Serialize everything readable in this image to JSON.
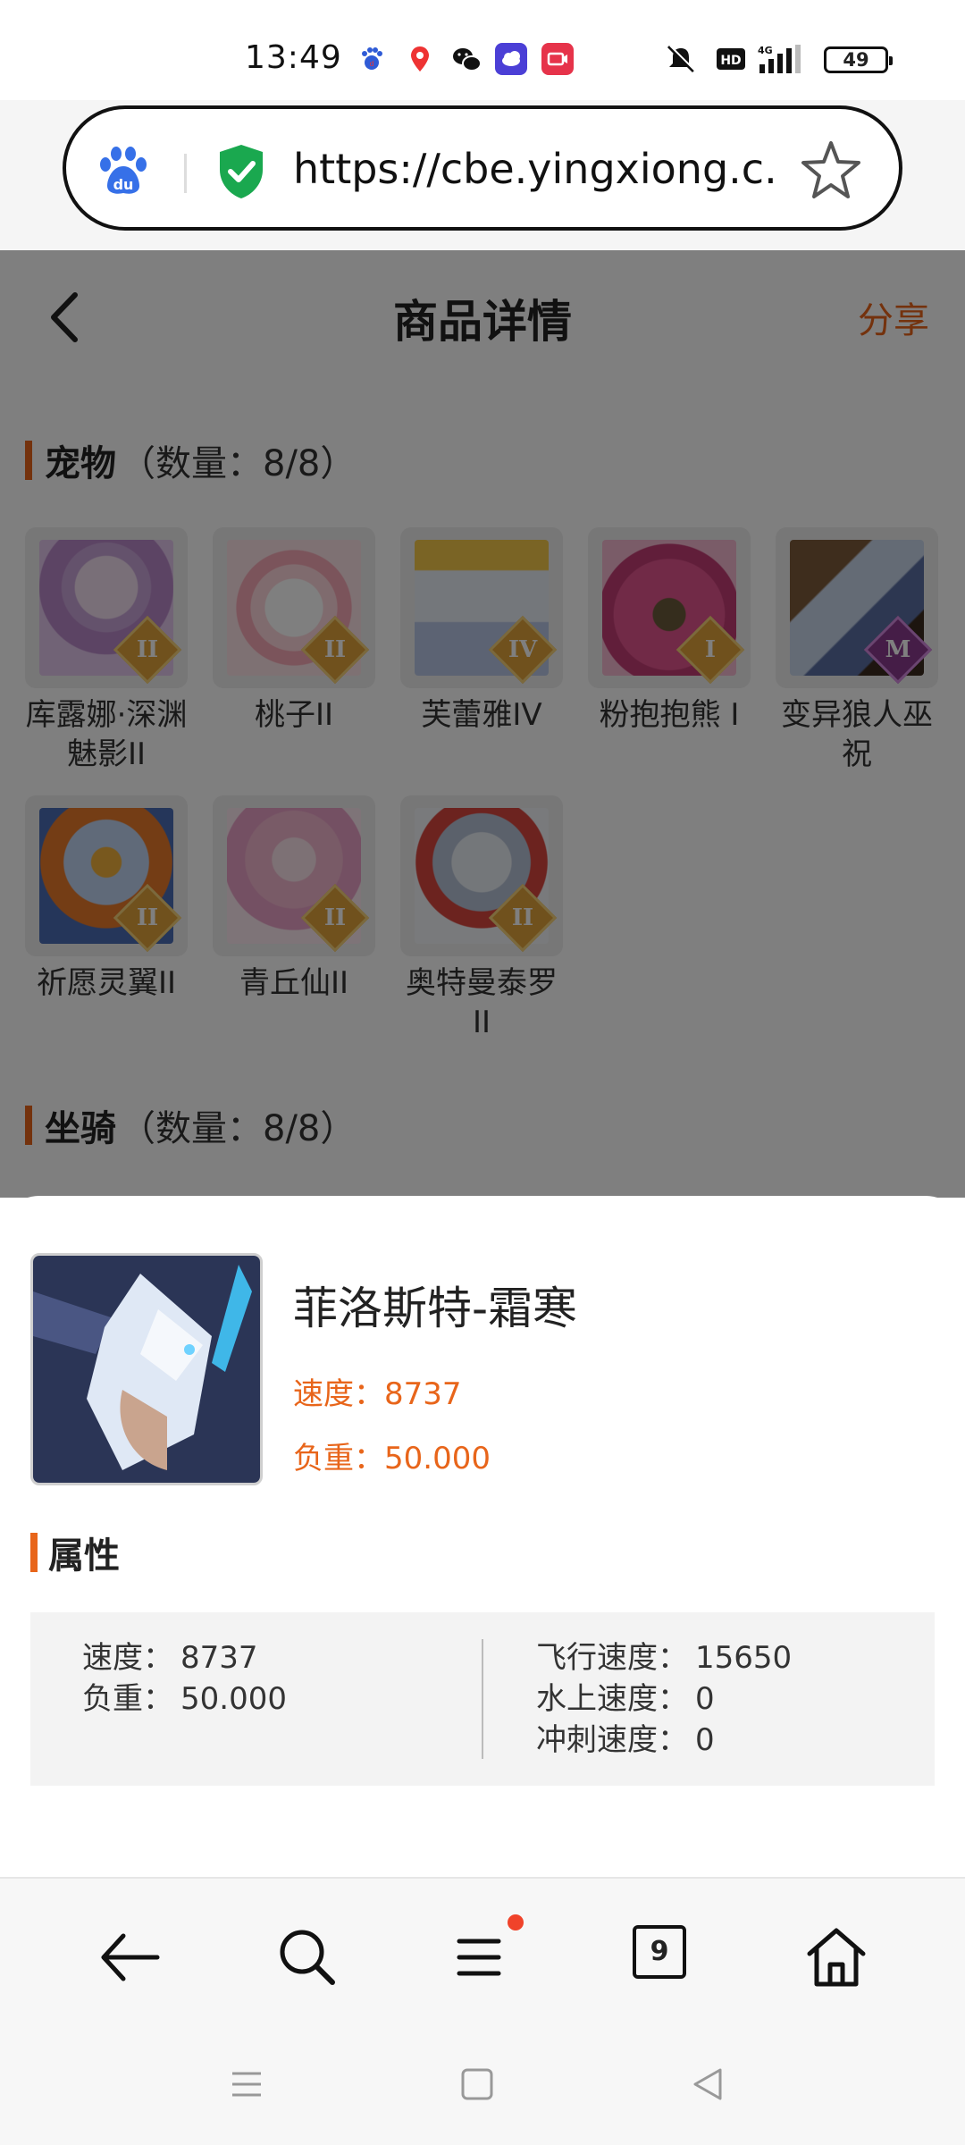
{
  "status_bar": {
    "time": "13:49",
    "battery": "49"
  },
  "browser": {
    "url": "https://cbe.yingxiong.c...",
    "tab_count": "9"
  },
  "page": {
    "title": "商品详情",
    "share_label": "分享",
    "pets_section": {
      "name": "宠物",
      "count": "（数量：8/8）"
    },
    "pets": [
      {
        "name": "库露娜·深渊魅影II",
        "tier": "II"
      },
      {
        "name": "桃子II",
        "tier": "II"
      },
      {
        "name": "芙蕾雅IV",
        "tier": "IV"
      },
      {
        "name": "粉抱抱熊 I",
        "tier": "I"
      },
      {
        "name": "变异狼人巫祝",
        "tier": "M"
      },
      {
        "name": "祈愿灵翼II",
        "tier": "II"
      },
      {
        "name": "青丘仙II",
        "tier": "II"
      },
      {
        "name": "奥特曼泰罗II",
        "tier": "II"
      }
    ],
    "mounts_section": {
      "name": "坐骑",
      "count": "（数量：8/8）"
    }
  },
  "sheet": {
    "item_name": "菲洛斯特-霜寒",
    "speed_label": "速度：",
    "speed_value": "8737",
    "load_label": "负重：",
    "load_value": "50.000",
    "attr_title": "属性",
    "attributes_left": [
      {
        "label": "速度：",
        "value": "8737"
      },
      {
        "label": "负重：",
        "value": "50.000"
      }
    ],
    "attributes_right": [
      {
        "label": "飞行速度：",
        "value": "15650"
      },
      {
        "label": "水上速度：",
        "value": "0"
      },
      {
        "label": "冲刺速度：",
        "value": "0"
      }
    ]
  },
  "colors": {
    "accent": "#e8651a",
    "notification_dot": "#f0432a"
  },
  "icons": {
    "url_bar": [
      "baidu-paw-icon",
      "security-shield-icon",
      "bookmark-star-icon"
    ],
    "toolbar": [
      "back-arrow-icon",
      "search-icon",
      "menu-icon",
      "tabs-icon",
      "home-icon"
    ],
    "system_nav": [
      "recents-icon",
      "home-square-icon",
      "back-triangle-icon"
    ]
  }
}
